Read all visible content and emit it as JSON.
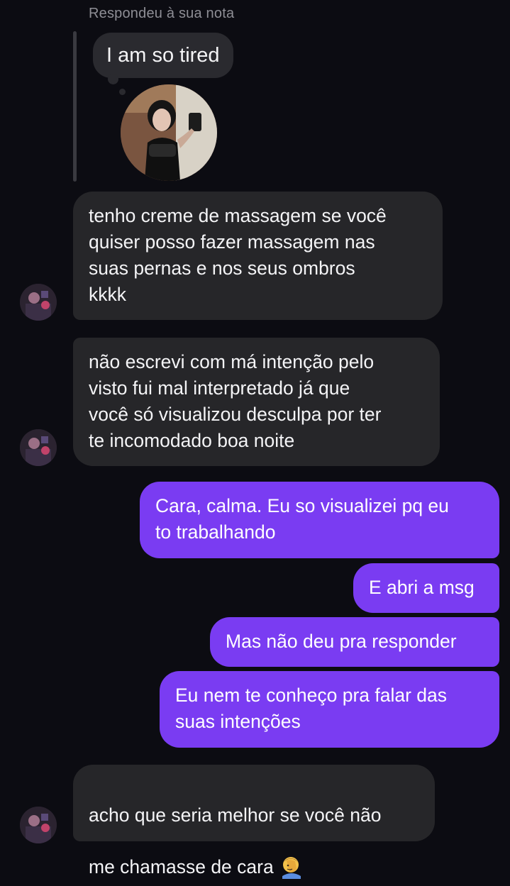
{
  "reply_context": {
    "label": "Respondeu à sua nota",
    "note_text": "I am so tired"
  },
  "messages": [
    {
      "direction": "incoming",
      "text": "tenho creme de massagem se você\nquiser posso fazer massagem nas\nsuas pernas e nos seus ombros\nkkkk"
    },
    {
      "direction": "incoming",
      "text": "não escrevi com má intenção pelo\nvisto fui mal interpretado já que\nvocê só visualizou desculpa por ter\nte incomodado boa noite"
    },
    {
      "direction": "outgoing",
      "text": "Cara, calma. Eu so visualizei pq eu\nto trabalhando"
    },
    {
      "direction": "outgoing",
      "text": "E abri a msg"
    },
    {
      "direction": "outgoing",
      "text": "Mas não deu pra responder"
    },
    {
      "direction": "outgoing",
      "text": "Eu nem te conheço pra falar das\nsuas intenções"
    },
    {
      "direction": "incoming",
      "text": "acho que seria melhor se você não\nme chamasse de cara",
      "emoji": "man-facepalming-icon"
    }
  ],
  "colors": {
    "background": "#0c0c12",
    "incoming_bubble": "#262629",
    "outgoing_bubble": "#7a3cf2",
    "secondary_text": "#8e8e95"
  }
}
